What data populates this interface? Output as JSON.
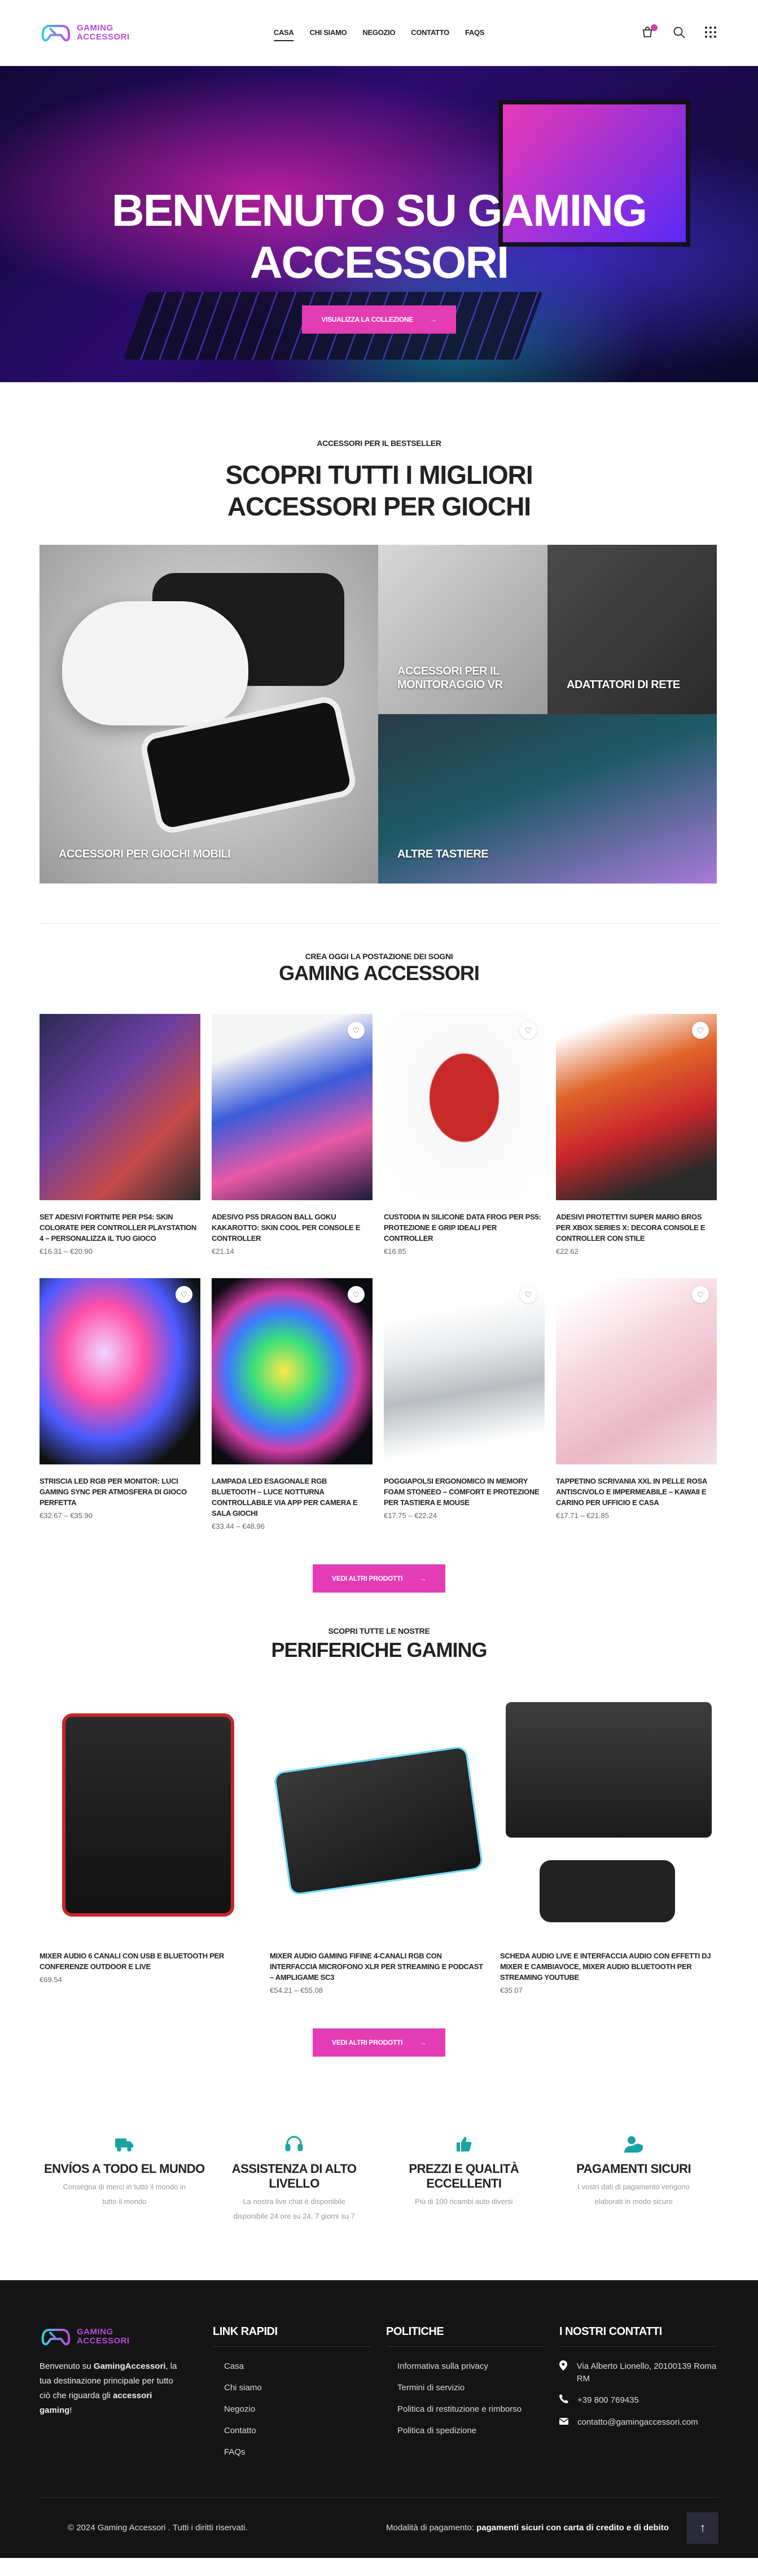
{
  "brand": {
    "line1": "Gaming",
    "line2": "Accessori"
  },
  "nav": [
    "Casa",
    "Chi siamo",
    "Negozio",
    "Contatto",
    "FAQs"
  ],
  "hero": {
    "title": "Benvenuto su Gaming Accessori",
    "cta": "Visualizza la collezione"
  },
  "bestseller": {
    "subtitle": "Accessori per il bestseller",
    "title_line1": "Scopri tutti i migliori",
    "title_line2": "accessori per giochi",
    "tiles": {
      "big": "Accessori per giochi mobili",
      "vr": "Accessori per il monitoraggio VR",
      "adapters": "Adattatori di rete",
      "keyboards": "Altre tastiere"
    }
  },
  "gaming": {
    "subtitle": "Crea oggi la postazione dei sogni",
    "title": "Gaming Accessori",
    "products": [
      {
        "title": "Set Adesivi Fortnite per PS4: Skin Colorate per Controller PlayStation 4 – Personalizza il tuo Gioco",
        "price": "€16.31 – €20.90"
      },
      {
        "title": "Adesivo PS5 Dragon Ball Goku Kakarotto: Skin Cool per Console e Controller",
        "price": "€21.14"
      },
      {
        "title": "Custodia in Silicone Data Frog per PS5: Protezione e Grip Ideali per Controller",
        "price": "€16.85"
      },
      {
        "title": "Adesivi Protettivi Super Mario Bros per Xbox Series X: Decora Console e Controller con Stile",
        "price": "€22.62"
      },
      {
        "title": "Striscia LED RGB per Monitor: Luci Gaming Sync per Atmosfera di Gioco Perfetta",
        "price": "€32.67 – €35.90"
      },
      {
        "title": "Lampada LED Esagonale RGB Bluetooth – Luce Notturna Controllabile via App per Camera e Sala Giochi",
        "price": "€33.44 – €48.96"
      },
      {
        "title": "Poggiapolsi Ergonomico in Memory Foam Stoneeo – Comfort e Protezione per Tastiera e Mouse",
        "price": "€17.75 – €22.24"
      },
      {
        "title": "Tappetino Scrivania XXL in Pelle Rosa Antiscivolo e Impermeabile – Kawaii e Carino per Ufficio e Casa",
        "price": "€17.71 – €21.85"
      }
    ],
    "more_cta": "Vedi altri prodotti"
  },
  "periph": {
    "subtitle": "Scopri tutte le nostre",
    "title": "periferiche gaming",
    "products": [
      {
        "title": "Mixer Audio 6 Canali con USB e Bluetooth per Conferenze Outdoor e Live",
        "price": "€69.54"
      },
      {
        "title": "Mixer Audio Gaming FIFINE 4-Canali RGB con Interfaccia Microfono XLR per Streaming e Podcast – AmpliGame SC3",
        "price": "€54.21 – €55.08"
      },
      {
        "title": "Scheda Audio Live e Interfaccia Audio con Effetti DJ Mixer e Cambiavoce, Mixer Audio Bluetooth per Streaming YouTube",
        "price": "€35.07"
      }
    ],
    "more_cta": "Vedi altri prodotti"
  },
  "features": [
    {
      "icon": "truck-icon",
      "title": "Envíos a todo el mundo",
      "text": "Consegna di merci in tutto il mondo in tutto il mondo"
    },
    {
      "icon": "headset-icon",
      "title": "Assistenza di alto livello",
      "text": "La nostra live chat è disponibile disponibile 24 ore su 24, 7 giorni su 7"
    },
    {
      "icon": "thumbs-up-icon",
      "title": "Prezzi e qualità eccellenti",
      "text": "Più di 100 ricambi auto diversi"
    },
    {
      "icon": "user-shield-icon",
      "title": "Pagamenti sicuri",
      "text": "I vostri dati di pagamento vengono elaborati in modo sicuro"
    }
  ],
  "footer": {
    "about_pre": "Benvenuto su ",
    "about_brand": "GamingAccessori",
    "about_mid": ", la tua destinazione principale per tutto ciò che riguarda gli ",
    "about_bold": "accessori gaming",
    "about_end": "!",
    "links_title": "Link rapidi",
    "links": [
      "Casa",
      "Chi siamo",
      "Negozio",
      "Contatto",
      "FAQs"
    ],
    "policy_title": "Politiche",
    "policies": [
      "Informativa sulla privacy",
      "Termini di servizio",
      "Politica di restituzione e rimborso",
      "Politica di spedizione"
    ],
    "contact_title": "I nostri contatti",
    "address": "Via Alberto Lionello, 20100139 Roma RM",
    "phone": "+39 800 769435",
    "email": "contatto@gamingaccessori.com",
    "copyright": "© 2024 Gaming Accessori . Tutti i diritti riservati.",
    "payment_pre": "Modalità di pagamento: ",
    "payment_bold": "pagamenti sicuri con carta di credito e di debito"
  },
  "colors": {
    "accent": "#e43db4",
    "teal": "#1aa3a3",
    "footer_bg": "#141414"
  }
}
